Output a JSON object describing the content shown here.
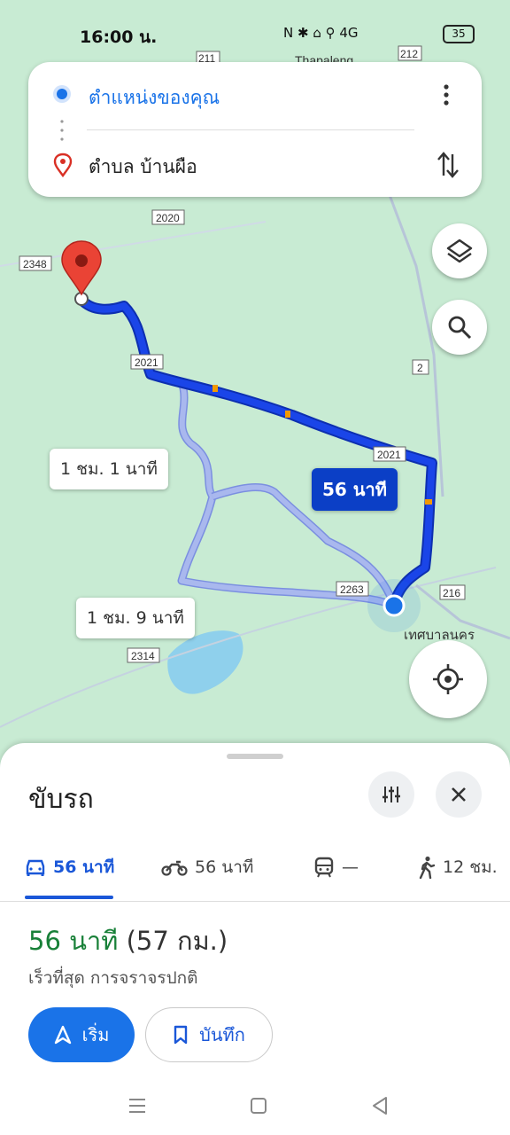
{
  "status": {
    "time": "16:00 น.",
    "indicators": "N ✱ ⌂ ⚲ 4G",
    "battery": "35"
  },
  "search": {
    "origin": "ตำแหน่งของคุณ",
    "destination": "ตำบล บ้านผือ"
  },
  "map": {
    "place_top": "Thapaleng",
    "place_bottom": "เทศบาลนคร",
    "road_labels": [
      "2020",
      "2348",
      "2021",
      "2",
      "2021",
      "216",
      "2263",
      "2314",
      "211",
      "212"
    ]
  },
  "route_labels": {
    "alt1": "1 ชม. 1 นาที",
    "alt2": "1 ชม. 9 นาที",
    "primary": "56 นาที"
  },
  "sheet": {
    "title": "ขับรถ",
    "modes": [
      {
        "icon": "car-icon",
        "label": "56 นาที"
      },
      {
        "icon": "motorcycle-icon",
        "label": "56 นาที"
      },
      {
        "icon": "transit-icon",
        "label": "—"
      },
      {
        "icon": "walk-icon",
        "label": "12 ชม."
      }
    ],
    "duration": "56 นาที",
    "distance": "(57 กม.)",
    "subtitle": "เร็วที่สุด การจราจรปกติ",
    "start_label": "เริ่ม",
    "save_label": "บันทึก"
  },
  "colors": {
    "route_primary": "#1a45e8",
    "route_alt": "#a9b8ee",
    "accent": "#1a73e8",
    "duration_green": "#188038"
  }
}
